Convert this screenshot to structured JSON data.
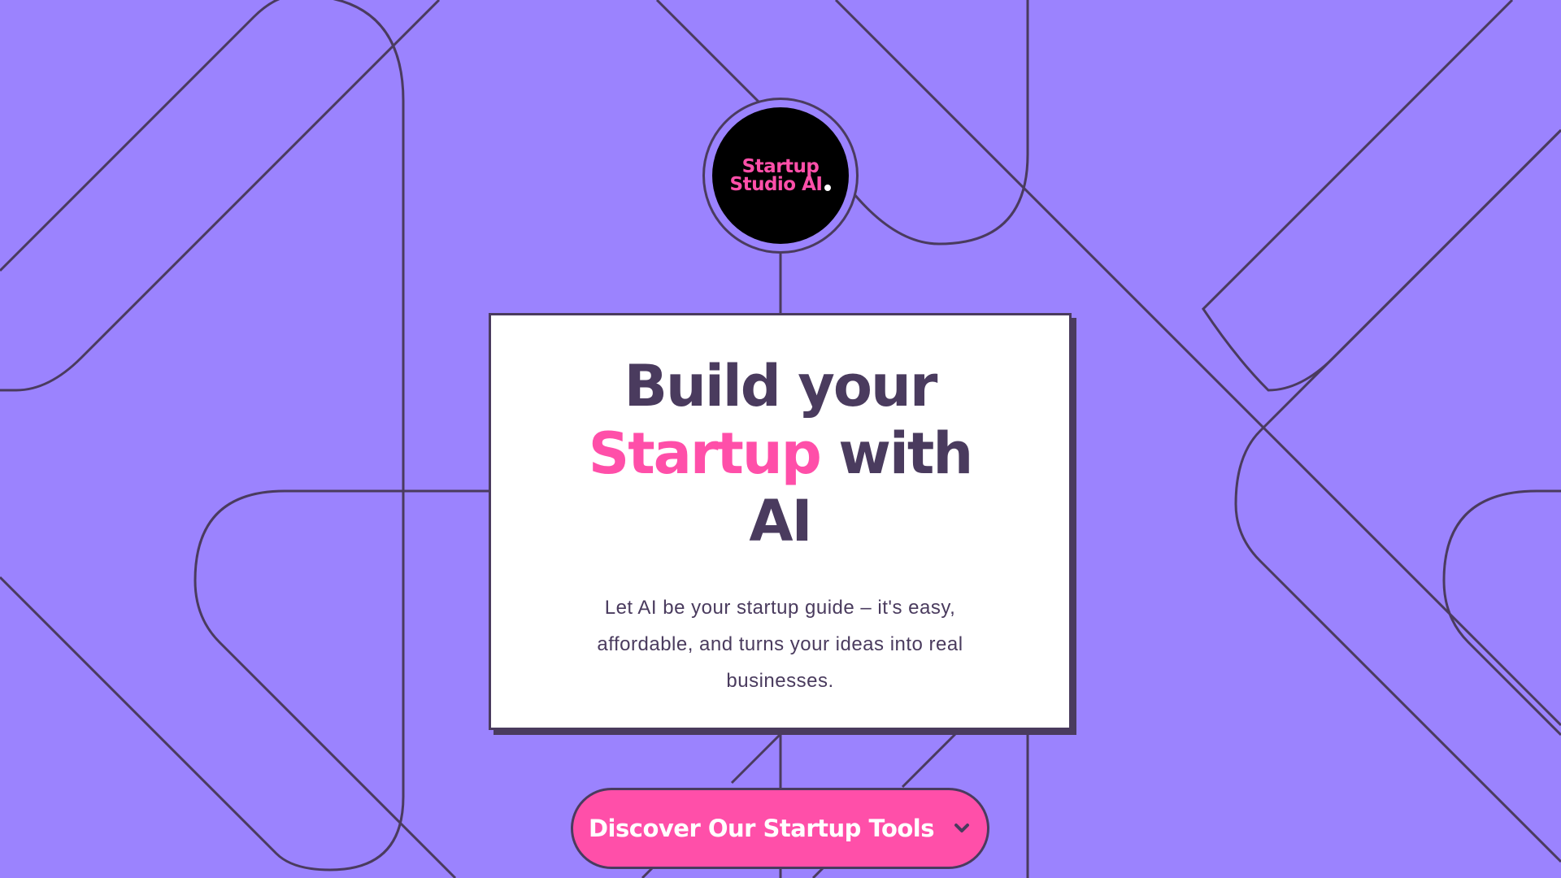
{
  "brand": {
    "line1": "Startup",
    "line2": "Studio AI",
    "colors": {
      "background": "#9b83fe",
      "accent": "#ff4fa9",
      "ink": "#4a3b5e",
      "logo_bg": "#000000"
    }
  },
  "hero": {
    "headline_part1": "Build your",
    "headline_accent": "Startup",
    "headline_part2": "with",
    "headline_part3": "AI",
    "description": "Let AI be your startup guide – it's easy, affordable, and turns your ideas into real businesses."
  },
  "cta": {
    "label": "Discover Our Startup Tools",
    "icon": "chevron-down-icon"
  }
}
